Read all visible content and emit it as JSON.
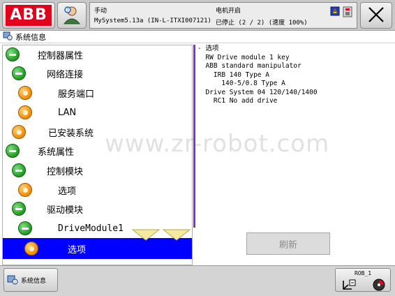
{
  "header": {
    "logo_text": "ABB",
    "status": {
      "mode": "手动",
      "system": "MySystem5.13a (IN-L-ITXI007121)",
      "motor_state": "电机开启",
      "run_state": "已停止 (2 / 2) (速度 100%)"
    }
  },
  "window": {
    "title": "系统信息"
  },
  "tree": {
    "items": [
      {
        "label": "控制器属性",
        "level": 0,
        "icon": "collapse-icon",
        "selected": false
      },
      {
        "label": "网络连接",
        "level": 1,
        "icon": "collapse-icon",
        "selected": false
      },
      {
        "label": "服务端口",
        "level": 2,
        "icon": "leaf-icon",
        "selected": false
      },
      {
        "label": "LAN",
        "level": 2,
        "icon": "leaf-icon",
        "selected": false
      },
      {
        "label": "已安装系统",
        "level": 1,
        "icon": "leaf-icon",
        "selected": false
      },
      {
        "label": "系统属性",
        "level": 0,
        "icon": "collapse-icon",
        "selected": false
      },
      {
        "label": "控制模块",
        "level": 1,
        "icon": "collapse-icon",
        "selected": false
      },
      {
        "label": "选项",
        "level": 2,
        "icon": "leaf-icon",
        "selected": false
      },
      {
        "label": "驱动模块",
        "level": 1,
        "icon": "collapse-icon",
        "selected": false
      },
      {
        "label": "DriveModule1",
        "level": 2,
        "icon": "collapse-icon",
        "selected": false
      },
      {
        "label": "选项",
        "level": 3,
        "icon": "leaf-icon",
        "selected": true
      }
    ]
  },
  "detail": {
    "lines": [
      "- 选项",
      "  RW Drive module 1 key",
      "  ABB standard manipulator",
      "    IRB 140 Type A",
      "      140-5/0.8 Type A",
      "  Drive System 04 120/140/1400",
      "    RC1 No add drive"
    ],
    "refresh_label": "刷新"
  },
  "footer": {
    "task_label": "系统信息",
    "quickset_label": "ROB_1"
  },
  "watermark": "www.zr-robot.com",
  "colors": {
    "abb_red": "#e2001a",
    "selection_blue": "#0000ff",
    "tree_separator": "#8a2be2",
    "expand_green": "#1f9a1f",
    "leaf_orange": "#f08a00"
  }
}
